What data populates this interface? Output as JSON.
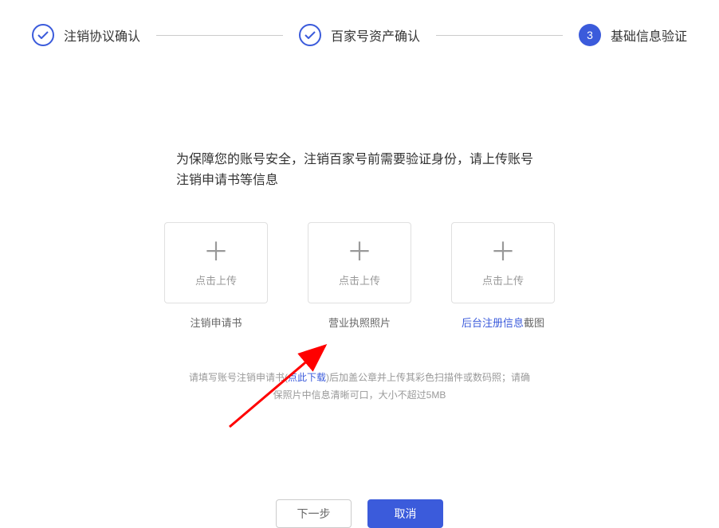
{
  "stepper": {
    "step1": {
      "label": "注销协议确认"
    },
    "step2": {
      "label": "百家号资产确认"
    },
    "step3": {
      "number": "3",
      "label": "基础信息验证"
    }
  },
  "instruction": "为保障您的账号安全，注销百家号前需要验证身份，请上传账号注销申请书等信息",
  "uploads": {
    "uploadText": "点击上传",
    "box1": {
      "label": "注销申请书"
    },
    "box2": {
      "label": "营业执照照片"
    },
    "box3": {
      "labelBlue": "后台注册信息",
      "labelSuffix": "截图"
    }
  },
  "hint": {
    "prefix": "请填写账号注销申请书(",
    "link": "点此下载",
    "suffix": ")后加盖公章并上传其彩色扫描件或数码照；请确",
    "line2": "保照片中信息清晰可口，大小不超过5MB"
  },
  "buttons": {
    "next": "下一步",
    "cancel": "取消"
  }
}
